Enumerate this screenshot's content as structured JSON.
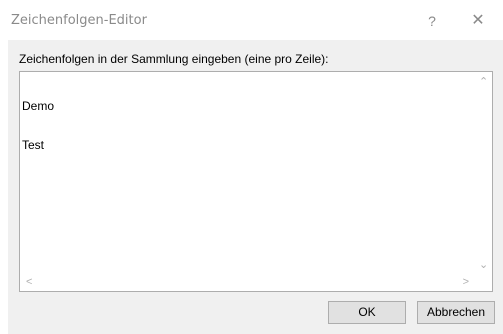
{
  "window": {
    "title": "Zeichenfolgen-Editor",
    "help_glyph": "?",
    "close_glyph": "✕"
  },
  "prompt": "Zeichenfolgen in der Sammlung eingeben (eine pro Zeile):",
  "editor": {
    "lines": [
      "Demo",
      "Test"
    ]
  },
  "scroll_glyphs": {
    "up": "⌃",
    "down": "⌄",
    "left": "<",
    "right": ">"
  },
  "buttons": {
    "ok": "OK",
    "cancel": "Abbrechen"
  },
  "colors": {
    "title_text": "#8a8a8a",
    "client_bg": "#f0f0f0",
    "button_bg": "#e1e1e1",
    "border": "#adadad"
  }
}
